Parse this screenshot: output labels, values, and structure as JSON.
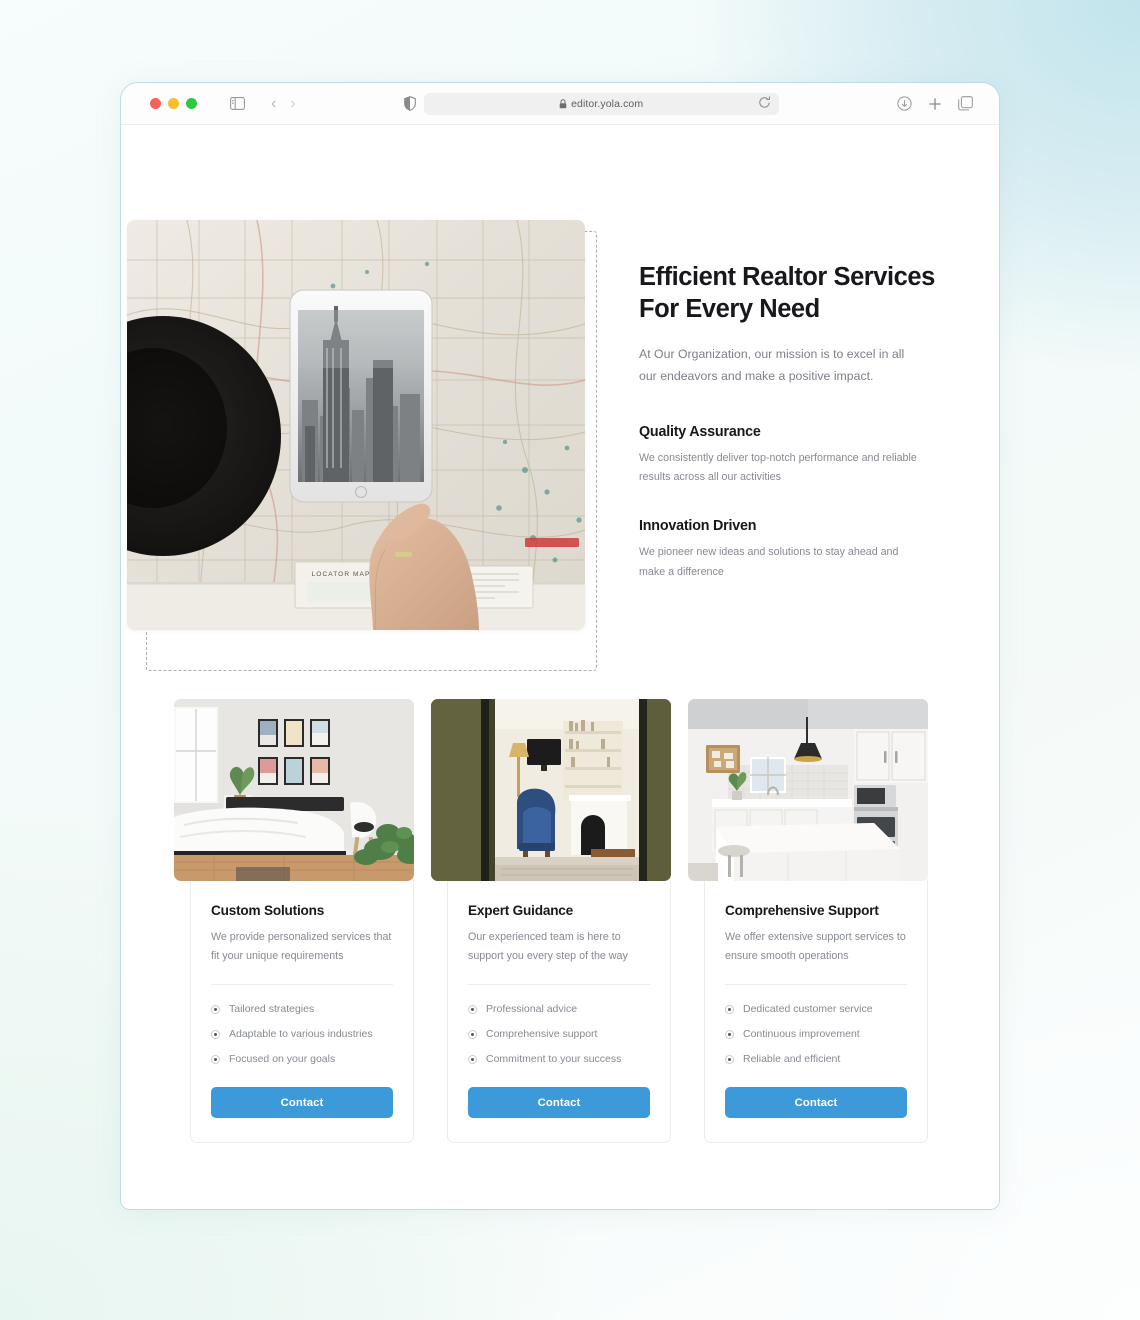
{
  "browser": {
    "url": "editor.yola.com",
    "lock_icon": "lock-icon",
    "reload_icon": "reload-icon",
    "sidebar_icon": "sidebar-toggle-icon",
    "back_icon": "chevron-left-icon",
    "forward_icon": "chevron-right-icon",
    "shield_icon": "privacy-shield-icon",
    "download_icon": "download-icon",
    "new_tab_icon": "plus-icon",
    "tabs_icon": "tab-overview-icon",
    "traffic_lights": [
      "close-red",
      "minimize-yellow",
      "zoom-green"
    ]
  },
  "hero": {
    "title": "Efficient Realtor Services For Every Need",
    "subtitle": "At Our Organization, our mission is to excel in all our endeavors and make a positive impact.",
    "image_alt": "hand-on-map-with-tablet-showing-city-skyline",
    "features": [
      {
        "title": "Quality Assurance",
        "body": "We consistently deliver top-notch performance and reliable results across all our activities"
      },
      {
        "title": "Innovation Driven",
        "body": "We pioneer new ideas and solutions to stay ahead and make a difference"
      }
    ]
  },
  "cards": [
    {
      "image_alt": "bedroom-with-framed-art-and-plant",
      "title": "Custom Solutions",
      "description": "We provide personalized services that fit your unique requirements",
      "bullets": [
        "Tailored strategies",
        "Adaptable to various industries",
        "Focused on your goals"
      ],
      "button_label": "Contact"
    },
    {
      "image_alt": "living-room-with-blue-armchair-and-bookshelf",
      "title": "Expert Guidance",
      "description": "Our experienced team is here to support you every step of the way",
      "bullets": [
        "Professional advice",
        "Comprehensive support",
        "Commitment to your success"
      ],
      "button_label": "Contact"
    },
    {
      "image_alt": "modern-white-kitchen-with-island-and-pendant-lamp",
      "title": "Comprehensive Support",
      "description": "We offer extensive support services to ensure smooth operations",
      "bullets": [
        "Dedicated customer service",
        "Continuous improvement",
        "Reliable and efficient"
      ],
      "button_label": "Contact"
    }
  ],
  "colors": {
    "accent_button": "#3c9ada",
    "heading": "#17181c",
    "body_text": "#868a91",
    "selection_dash": "#adadad",
    "window_border": "#bcdcea"
  }
}
